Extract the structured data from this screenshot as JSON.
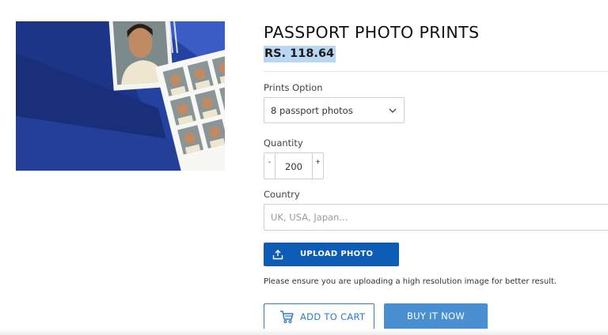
{
  "product": {
    "title": "PASSPORT PHOTO PRINTS",
    "price": "RS. 118.64",
    "image_icon": "passport-photo-sheet-image"
  },
  "prints_option": {
    "label": "Prints Option",
    "selected": "8 passport photos",
    "icon": "chevron-down-icon"
  },
  "quantity": {
    "label": "Quantity",
    "value": "200",
    "minus": "-",
    "plus": "+"
  },
  "country": {
    "label": "Country",
    "placeholder": "UK, USA, Japan..."
  },
  "upload": {
    "label": "UPLOAD PHOTO",
    "icon": "upload-icon"
  },
  "note": "Please ensure you are uploading a high resolution image for better result.",
  "actions": {
    "add_to_cart": "ADD TO CART",
    "add_to_cart_icon": "cart-icon",
    "buy_now": "BUY IT NOW"
  },
  "colors": {
    "primary": "#0d5db6",
    "secondary": "#4a8fd1",
    "outline": "#2d7cc7",
    "price_highlight": "#b9d7f3"
  }
}
